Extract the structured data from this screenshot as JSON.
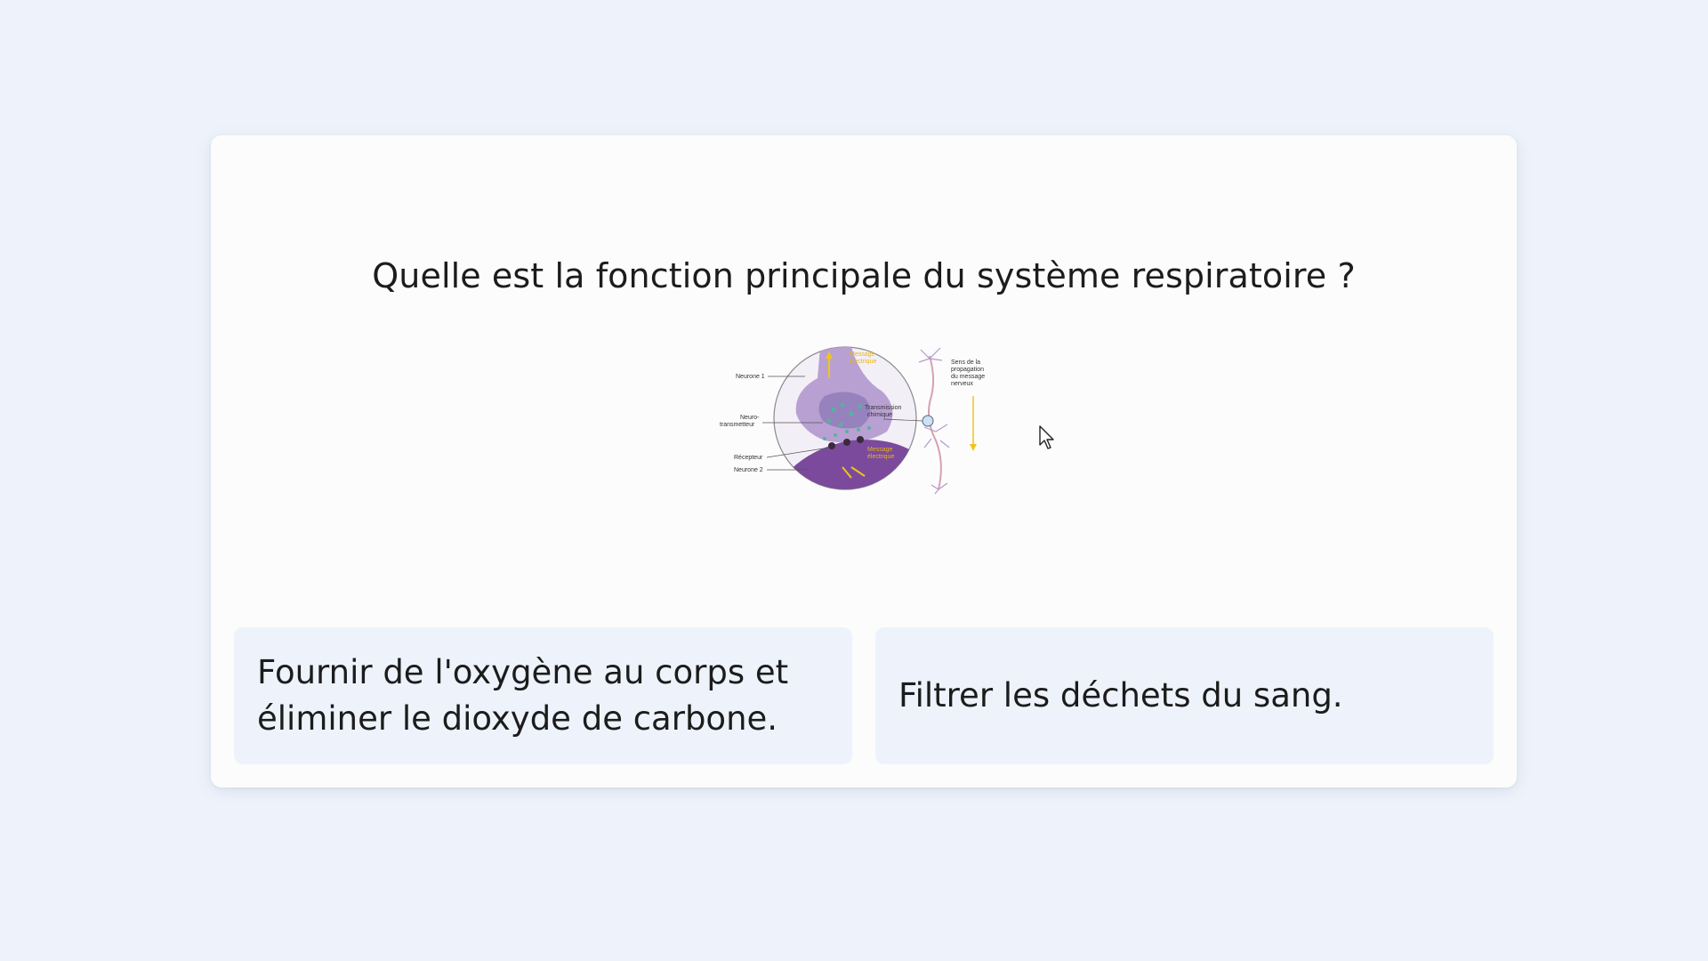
{
  "quiz": {
    "question": "Quelle est la fonction principale du système respiratoire ?",
    "answers": [
      {
        "label": "Fournir de l'oxygène au corps et éliminer le dioxyde de carbone."
      },
      {
        "label": "Filtrer les déchets du sang."
      }
    ]
  },
  "figure": {
    "labels": {
      "neurone1": "Neurone 1",
      "neurotransmetteur_1": "Neuro-",
      "neurotransmetteur_2": "transmetteur",
      "recepteur": "Récepteur",
      "neurone2": "Neurone 2",
      "message_top_1": "Message",
      "message_top_2": "électrique",
      "transmission_1": "Transmission",
      "transmission_2": "chimique",
      "message_bottom_1": "Message",
      "message_bottom_2": "électrique",
      "sens_1": "Sens de la",
      "sens_2": "propagation",
      "sens_3": "du message",
      "sens_4": "nerveux"
    }
  },
  "colors": {
    "page_background": "#eef3fb",
    "card_background": "#fcfcfc",
    "answer_background": "#eef3fb",
    "text": "#1c1c1c"
  }
}
